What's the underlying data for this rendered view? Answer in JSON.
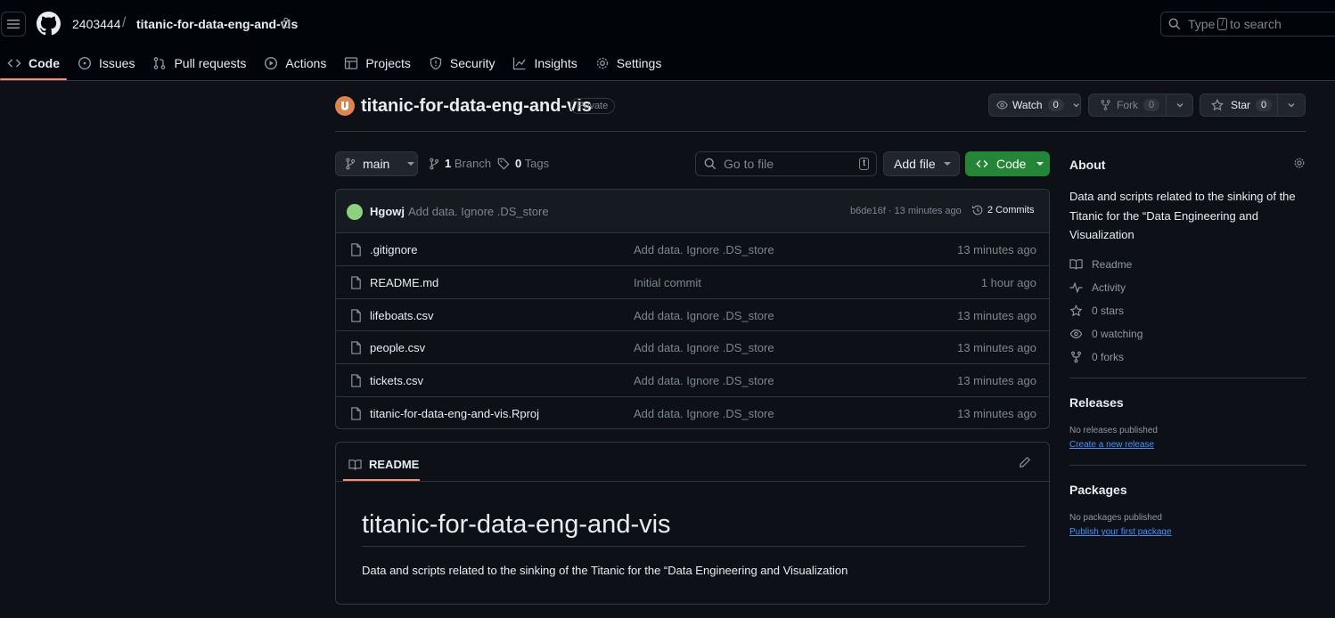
{
  "header": {
    "owner": "2403444",
    "separator": "/",
    "repo": "titanic-for-data-eng-and-vis",
    "search_prefix": "Type",
    "search_key": "/",
    "search_suffix": "to search"
  },
  "tabs": [
    {
      "label": "Code",
      "icon": "code-icon",
      "selected": true
    },
    {
      "label": "Issues",
      "icon": "issue-icon"
    },
    {
      "label": "Pull requests",
      "icon": "pull-request-icon"
    },
    {
      "label": "Actions",
      "icon": "play-icon"
    },
    {
      "label": "Projects",
      "icon": "table-icon"
    },
    {
      "label": "Security",
      "icon": "shield-icon"
    },
    {
      "label": "Insights",
      "icon": "graph-icon"
    },
    {
      "label": "Settings",
      "icon": "gear-icon"
    }
  ],
  "repo_header": {
    "title": "titanic-for-data-eng-and-vis",
    "visibility": "Private",
    "watch_label": "Watch",
    "watch_count": "0",
    "fork_label": "Fork",
    "fork_count": "0",
    "star_label": "Star",
    "star_count": "0"
  },
  "toolbar": {
    "branch": "main",
    "branches_count": "1",
    "branches_label": "Branch",
    "tags_count": "0",
    "tags_label": "Tags",
    "goto_placeholder": "Go to file",
    "goto_key": "t",
    "add_file": "Add file",
    "code": "Code"
  },
  "commit": {
    "author": "Hgowj",
    "message": "Add data. Ignore .DS_store",
    "hash_time": "b6de16f · 13 minutes ago",
    "commits": "2 Commits"
  },
  "files": [
    {
      "name": ".gitignore",
      "message": "Add data. Ignore .DS_store",
      "time": "13 minutes ago"
    },
    {
      "name": "README.md",
      "message": "Initial commit",
      "time": "1 hour ago"
    },
    {
      "name": "lifeboats.csv",
      "message": "Add data. Ignore .DS_store",
      "time": "13 minutes ago"
    },
    {
      "name": "people.csv",
      "message": "Add data. Ignore .DS_store",
      "time": "13 minutes ago"
    },
    {
      "name": "tickets.csv",
      "message": "Add data. Ignore .DS_store",
      "time": "13 minutes ago"
    },
    {
      "name": "titanic-for-data-eng-and-vis.Rproj",
      "message": "Add data. Ignore .DS_store",
      "time": "13 minutes ago"
    }
  ],
  "readme": {
    "tab": "README",
    "heading": "titanic-for-data-eng-and-vis",
    "body": "Data and scripts related to the sinking of the Titanic for the “Data Engineering and Visualization"
  },
  "about": {
    "heading": "About",
    "description": "Data and scripts related to the sinking of the Titanic for the “Data Engineering and Visualization",
    "items": [
      {
        "label": "Readme",
        "icon": "book-icon"
      },
      {
        "label": "Activity",
        "icon": "pulse-icon"
      },
      {
        "label": "0 stars",
        "icon": "star-icon"
      },
      {
        "label": "0 watching",
        "icon": "eye-icon"
      },
      {
        "label": "0 forks",
        "icon": "fork-icon"
      }
    ]
  },
  "releases": {
    "heading": "Releases",
    "empty": "No releases published",
    "link": "Create a new release"
  },
  "packages": {
    "heading": "Packages",
    "empty": "No packages published",
    "link": "Publish your first package"
  },
  "colors": {
    "background": "#0d1117",
    "header_bg": "#010409",
    "border": "#30363d",
    "accent_underline": "#fd8c73",
    "primary_button": "#238636",
    "link": "#4493f8"
  }
}
